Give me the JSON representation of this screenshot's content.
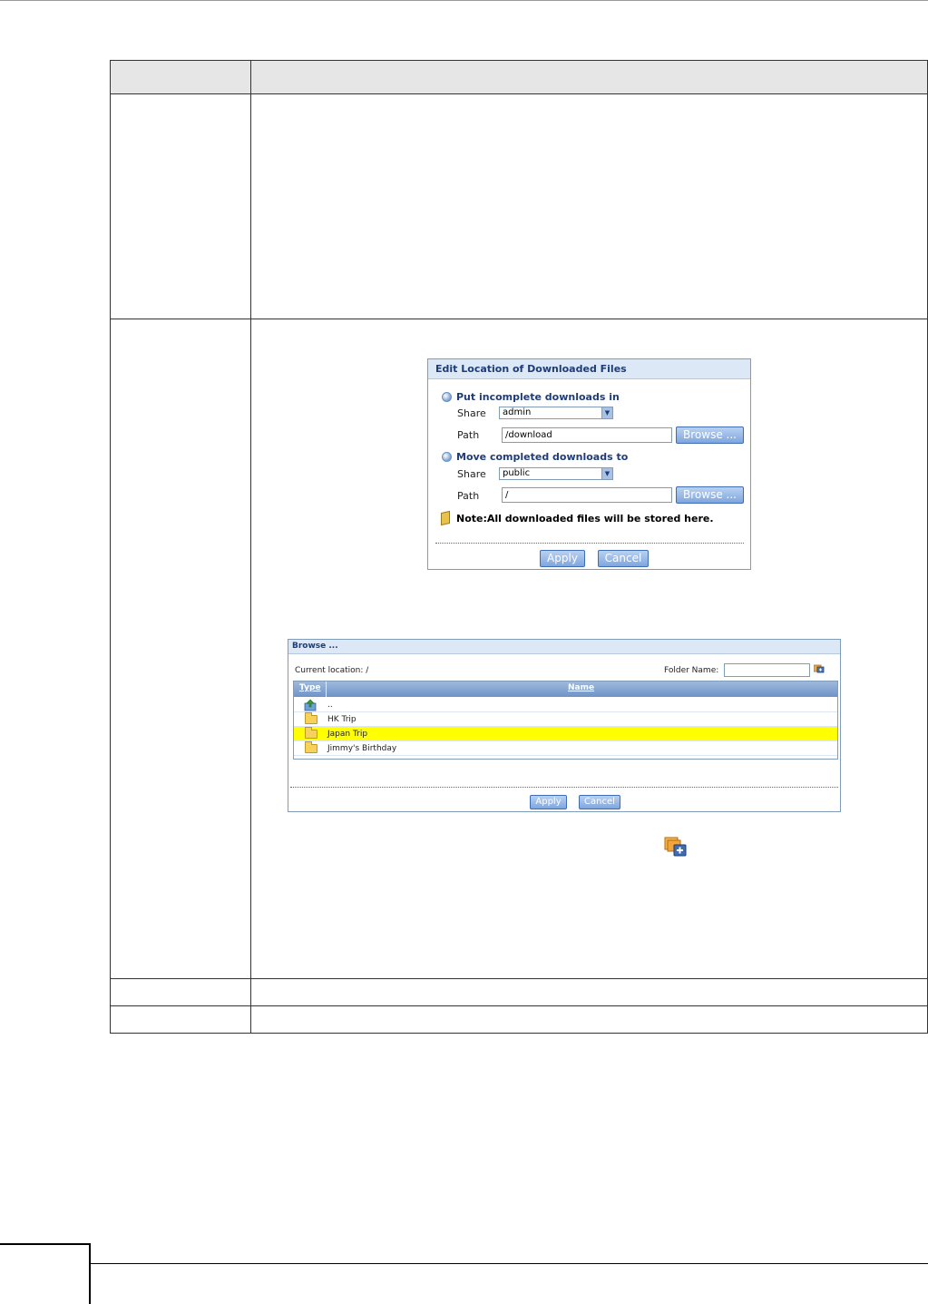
{
  "edit_dialog": {
    "title": "Edit Location of Downloaded Files",
    "section1": "Put incomplete downloads in",
    "section2": "Move completed downloads to",
    "share_label": "Share",
    "path_label": "Path",
    "share1_value": "admin",
    "path1_value": "/download",
    "share2_value": "public",
    "path2_value": "/",
    "browse_label": "Browse ...",
    "note": "Note:All downloaded files will be stored here.",
    "apply_label": "Apply",
    "cancel_label": "Cancel"
  },
  "browse_dialog": {
    "title": "Browse ...",
    "current_location": "Current location: /",
    "folder_name_label": "Folder Name:",
    "folder_name_value": "",
    "col_type": "Type",
    "col_name": "Name",
    "rows": [
      {
        "name": "..",
        "icon": "up-folder-icon",
        "selected": false
      },
      {
        "name": "HK Trip",
        "icon": "folder-icon",
        "selected": false
      },
      {
        "name": "Japan Trip",
        "icon": "folder-icon",
        "selected": true
      },
      {
        "name": "Jimmy's Birthday",
        "icon": "folder-icon",
        "selected": false
      }
    ],
    "apply_label": "Apply",
    "cancel_label": "Cancel"
  },
  "colors": {
    "dialog_border": "#7f9db9",
    "title_bg": "#dce8f5",
    "title_text": "#1f3c78",
    "selected_row": "#ffff00"
  }
}
